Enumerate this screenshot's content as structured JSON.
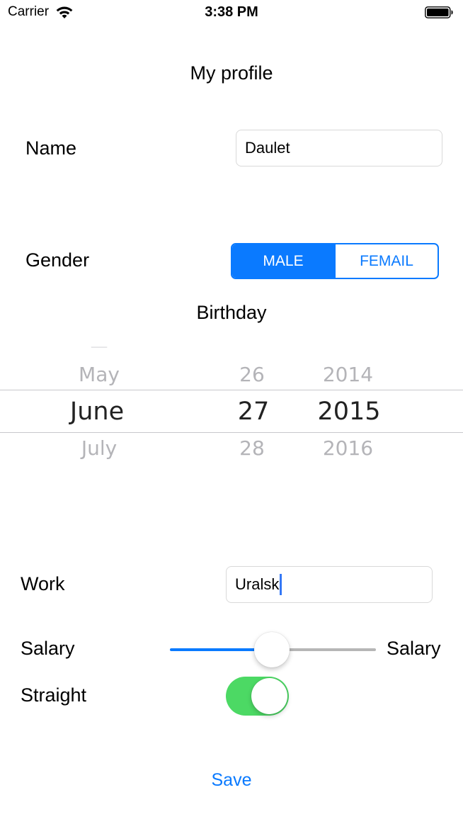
{
  "status_bar": {
    "carrier": "Carrier",
    "time": "3:38 PM",
    "wifi_icon": "wifi-icon",
    "battery_icon": "battery-icon"
  },
  "page": {
    "title": "My profile"
  },
  "name": {
    "label": "Name",
    "value": "Daulet"
  },
  "gender": {
    "label": "Gender",
    "options": [
      "MALE",
      "FEMAIL"
    ],
    "selected": "MALE"
  },
  "birthday": {
    "title": "Birthday",
    "picker": {
      "month": {
        "prev": "May",
        "selected": "June",
        "next": "July"
      },
      "day": {
        "prev": "26",
        "selected": "27",
        "next": "28"
      },
      "year": {
        "prev": "2014",
        "selected": "2015",
        "next": "2016"
      }
    }
  },
  "work": {
    "label": "Work",
    "value": "Uralsk"
  },
  "salary": {
    "label": "Salary",
    "value_label": "Salary",
    "slider_fraction": 0.49
  },
  "straight": {
    "label": "Straight",
    "on": true
  },
  "actions": {
    "save_label": "Save"
  },
  "colors": {
    "tint": "#0a7aff",
    "switch_on": "#4cd964"
  }
}
